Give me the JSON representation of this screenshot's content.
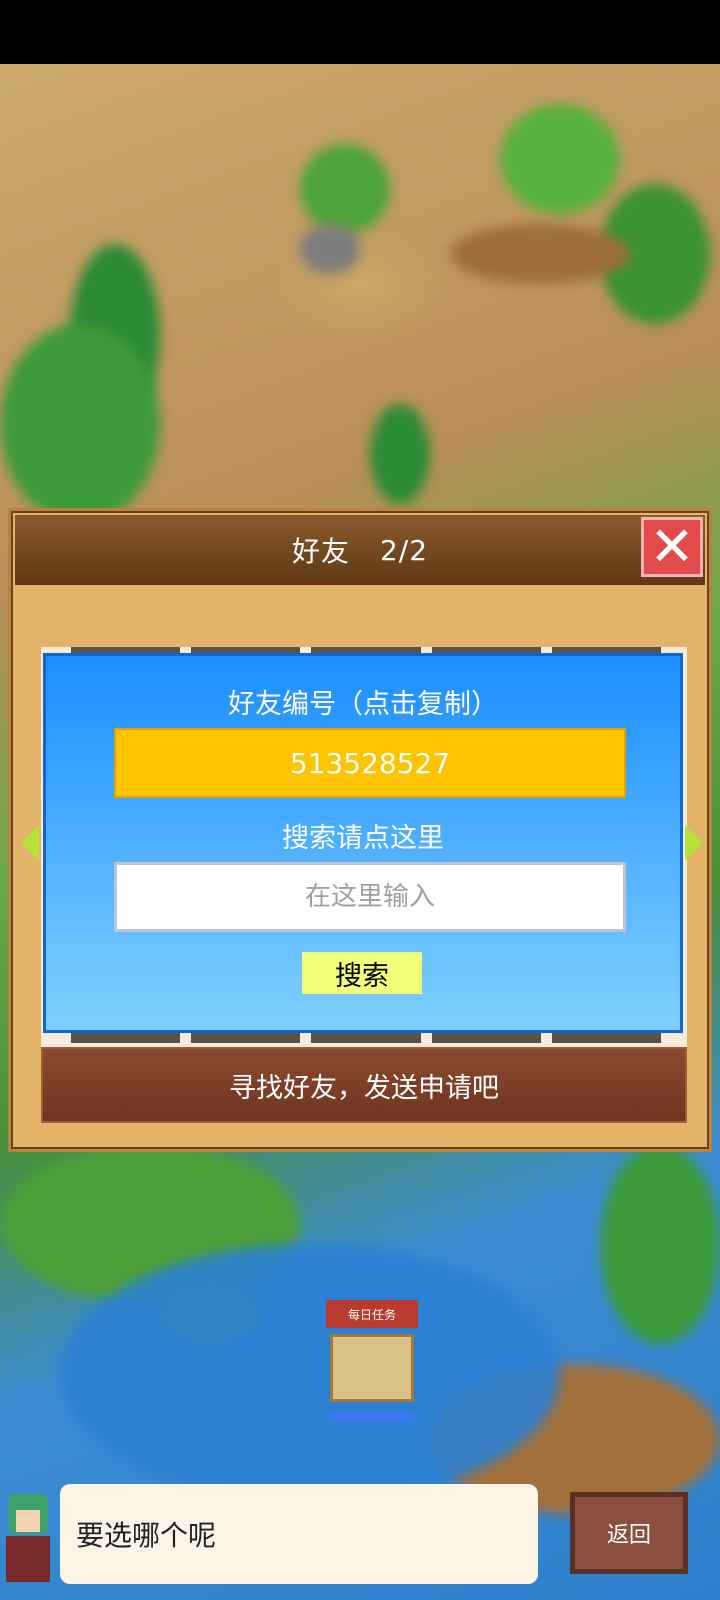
{
  "dialog": {
    "title": "好友",
    "page": "2/2",
    "close_label": "✕",
    "friend_code_label": "好友编号（点击复制）",
    "friend_code": "513528527",
    "search_label": "搜索请点这里",
    "search_placeholder": "在这里输入",
    "search_button": "搜索",
    "find_friends_label": "寻找好友，发送申请吧"
  },
  "daily_task": {
    "label": "每日任务"
  },
  "dialogue": {
    "message": "要选哪个呢",
    "back_button": "返回"
  },
  "colors": {
    "panel_blue": "#1c8eff",
    "code_yellow": "#ffc400",
    "close_red": "#e34b4b"
  }
}
